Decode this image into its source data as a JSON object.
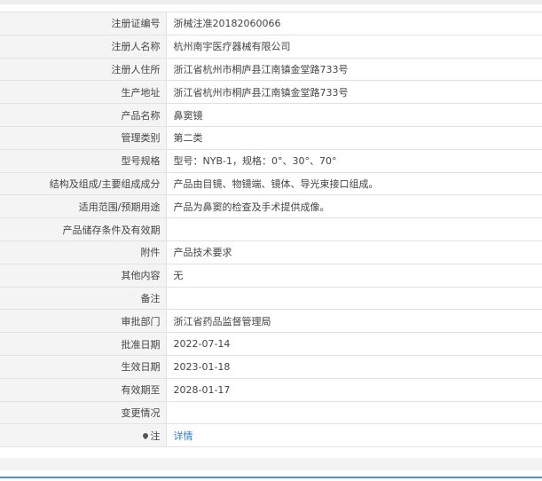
{
  "rows": [
    {
      "label": "注册证编号",
      "value": "浙械注准20182060066"
    },
    {
      "label": "注册人名称",
      "value": "杭州南宇医疗器械有限公司"
    },
    {
      "label": "注册人住所",
      "value": "浙江省杭州市桐庐县江南镇金堂路733号"
    },
    {
      "label": "生产地址",
      "value": "浙江省杭州市桐庐县江南镇金堂路733号"
    },
    {
      "label": "产品名称",
      "value": "鼻窦镜"
    },
    {
      "label": "管理类别",
      "value": "第二类"
    },
    {
      "label": "型号规格",
      "value": "型号：NYB-1，规格：0°、30°、70°"
    },
    {
      "label": "结构及组成/主要组成成分",
      "value": "产品由目镜、物镜端、镜体、导光束接口组成。"
    },
    {
      "label": "适用范围/预期用途",
      "value": "产品为鼻窦的检查及手术提供成像。"
    },
    {
      "label": "产品储存条件及有效期",
      "value": ""
    },
    {
      "label": "附件",
      "value": "产品技术要求"
    },
    {
      "label": "其他内容",
      "value": "无"
    },
    {
      "label": "备注",
      "value": ""
    },
    {
      "label": "审批部门",
      "value": "浙江省药品监督管理局"
    },
    {
      "label": "批准日期",
      "value": "2022-07-14"
    },
    {
      "label": "生效日期",
      "value": "2023-01-18"
    },
    {
      "label": "有效期至",
      "value": "2028-01-17"
    },
    {
      "label": "变更情况",
      "value": ""
    }
  ],
  "note": {
    "label": "注",
    "link": "详情",
    "icon": "map-pin-icon"
  }
}
